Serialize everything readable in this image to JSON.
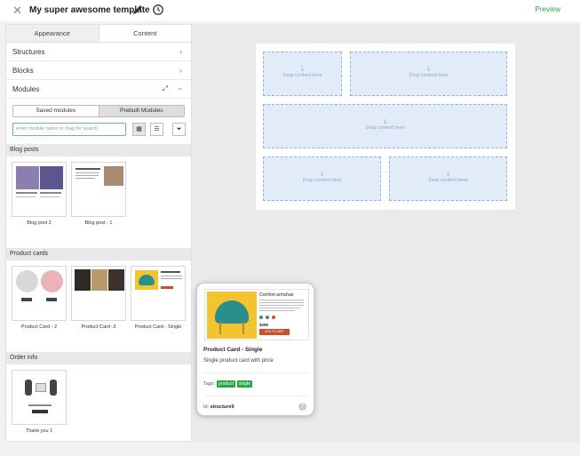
{
  "header": {
    "title": "My super awesome template",
    "preview_label": "Preview"
  },
  "sidebar": {
    "tabs": [
      "Appearance",
      "Content"
    ],
    "sections": {
      "structures": "Structures",
      "blocks": "Blocks",
      "modules": "Modules"
    },
    "module_toggle": {
      "saved": "Saved modules",
      "prebuilt": "Prebuilt Modules"
    },
    "search_placeholder": "enter module name or #tag for search",
    "categories": [
      {
        "name": "Blog posts",
        "items": [
          "Blog post 2",
          "Blog post - 1"
        ]
      },
      {
        "name": "Product cards",
        "items": [
          "Product Card - 2",
          "Product Card -3",
          "Product Card - Single"
        ]
      },
      {
        "name": "Order info",
        "items": [
          "Thank you 1"
        ]
      }
    ]
  },
  "canvas": {
    "drop_text": "Drop content here"
  },
  "popup": {
    "title": "Product Card - Single",
    "description": "Single product card with price",
    "tags_label": "Tags:",
    "tags": [
      "product",
      "single"
    ],
    "id_label": "Id:",
    "id_value": "structure9",
    "thumb_title": "Comfort armchair",
    "thumb_price": "$295",
    "thumb_button": "ADD TO CART"
  },
  "colors": {
    "accent_green": "#2fa148",
    "drop_fill": "#e1ecf8",
    "drop_border": "#8fb5dc",
    "chair_teal": "#2a8f8c",
    "chair_bg": "#f4c430",
    "button_orange": "#c8502a"
  }
}
